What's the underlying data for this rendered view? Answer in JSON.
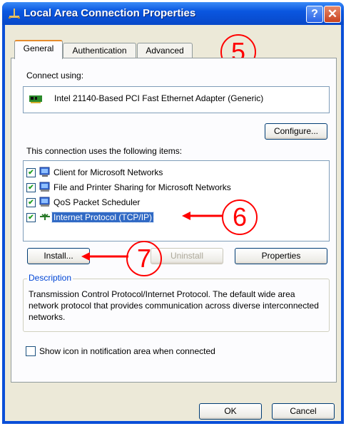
{
  "window": {
    "title": "Local Area Connection Properties"
  },
  "tabs": [
    {
      "label": "General",
      "active": true
    },
    {
      "label": "Authentication",
      "active": false
    },
    {
      "label": "Advanced",
      "active": false
    }
  ],
  "connect_using": {
    "label": "Connect using:",
    "adapter": "Intel 21140-Based PCI Fast Ethernet Adapter (Generic)",
    "configure_label": "Configure..."
  },
  "items": {
    "label": "This connection uses the following items:",
    "list": [
      {
        "label": "Client for Microsoft Networks",
        "checked": true,
        "icon": "network-client-icon"
      },
      {
        "label": "File and Printer Sharing for Microsoft Networks",
        "checked": true,
        "icon": "file-sharing-icon"
      },
      {
        "label": "QoS Packet Scheduler",
        "checked": true,
        "icon": "qos-icon"
      },
      {
        "label": "Internet Protocol (TCP/IP)",
        "checked": true,
        "icon": "protocol-icon",
        "selected": true
      }
    ]
  },
  "buttons": {
    "install": "Install...",
    "uninstall": "Uninstall",
    "properties": "Properties",
    "ok": "OK",
    "cancel": "Cancel"
  },
  "description": {
    "legend": "Description",
    "text": "Transmission Control Protocol/Internet Protocol. The default wide area network protocol that provides communication across diverse interconnected networks."
  },
  "notify": {
    "label": "Show icon in notification area when connected",
    "checked": false
  },
  "callouts": [
    "5",
    "6",
    "7"
  ],
  "colors": {
    "titlebar": "#0a56e0",
    "selection": "#316ac5",
    "callout": "#ff0000",
    "dialog_bg": "#ece9d8"
  }
}
